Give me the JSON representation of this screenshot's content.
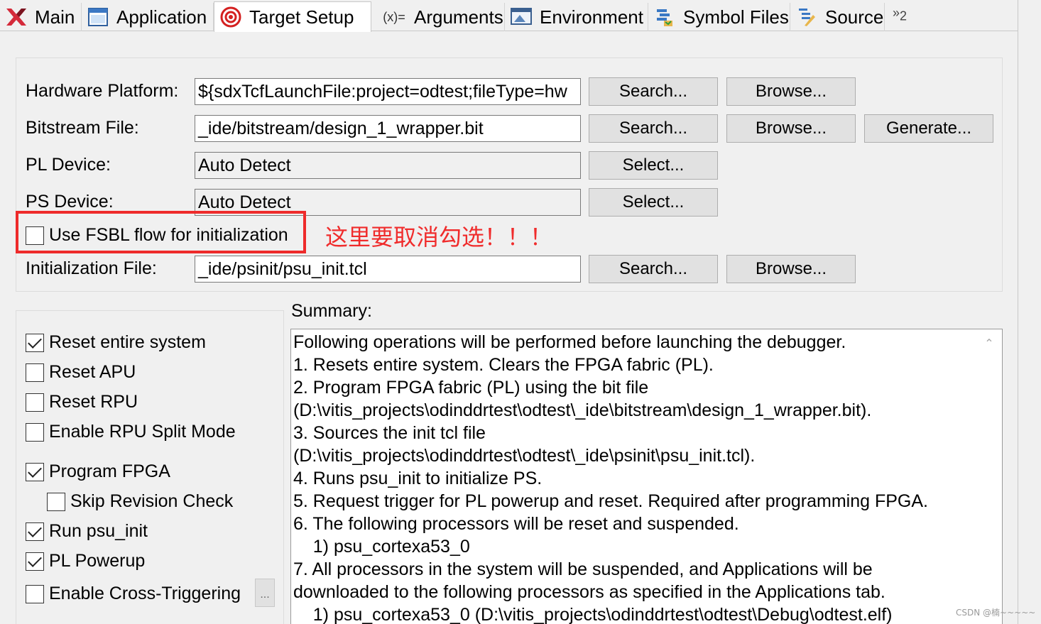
{
  "tabs": [
    {
      "label": "Main",
      "icon": "xilinx-logo-icon"
    },
    {
      "label": "Application",
      "icon": "application-window-icon"
    },
    {
      "label": "Target Setup",
      "icon": "target-icon"
    },
    {
      "label": "Arguments",
      "icon": "arguments-icon"
    },
    {
      "label": "Environment",
      "icon": "environment-icon"
    },
    {
      "label": "Symbol Files",
      "icon": "symbol-files-icon"
    },
    {
      "label": "Source",
      "icon": "source-icon"
    }
  ],
  "tab_overflow": {
    "symbol": "»",
    "count": "2"
  },
  "target": {
    "hardware_platform_label": "Hardware Platform:",
    "hardware_platform_value": "${sdxTcfLaunchFile:project=odtest;fileType=hw",
    "bitstream_label": "Bitstream File:",
    "bitstream_value": "_ide/bitstream/design_1_wrapper.bit",
    "pl_device_label": "PL Device:",
    "pl_device_value": "Auto Detect",
    "ps_device_label": "PS Device:",
    "ps_device_value": "Auto Detect",
    "fsbl_label": "Use FSBL flow for initialization",
    "init_label": "Initialization File:",
    "init_value": "_ide/psinit/psu_init.tcl",
    "search": "Search...",
    "browse": "Browse...",
    "generate": "Generate...",
    "select": "Select..."
  },
  "annotation": "这里要取消勾选！！！",
  "options": [
    {
      "label": "Reset entire system",
      "checked": true
    },
    {
      "label": "Reset APU",
      "checked": false
    },
    {
      "label": "Reset RPU",
      "checked": false
    },
    {
      "label": "Enable RPU Split Mode",
      "checked": false
    },
    {
      "label": "Program FPGA",
      "checked": true
    },
    {
      "label": "Skip Revision Check",
      "checked": false
    },
    {
      "label": "Run psu_init",
      "checked": true
    },
    {
      "label": "PL Powerup",
      "checked": true
    },
    {
      "label": "Enable Cross-Triggering",
      "checked": false
    }
  ],
  "ellipsis": "...",
  "summary": {
    "label": "Summary:",
    "lines": [
      "Following operations will be performed before launching the debugger.",
      "1. Resets entire system. Clears the FPGA fabric (PL).",
      "2. Program FPGA fabric (PL) using the bit file",
      "(D:\\vitis_projects\\odinddrtest\\odtest\\_ide\\bitstream\\design_1_wrapper.bit).",
      "3. Sources the init tcl file",
      "(D:\\vitis_projects\\odinddrtest\\odtest\\_ide\\psinit\\psu_init.tcl).",
      "4. Runs psu_init to initialize PS.",
      "5. Request trigger for PL powerup and reset. Required after programming FPGA.",
      "6. The following processors will be reset and suspended.",
      "    1) psu_cortexa53_0",
      "7. All processors in the system will be suspended, and Applications will be",
      "downloaded to the following processors as specified in the Applications tab.",
      "    1) psu_cortexa53_0 (D:\\vitis_projects\\odinddrtest\\odtest\\Debug\\odtest.elf)"
    ]
  },
  "watermark": "CSDN @楠~~~~~"
}
